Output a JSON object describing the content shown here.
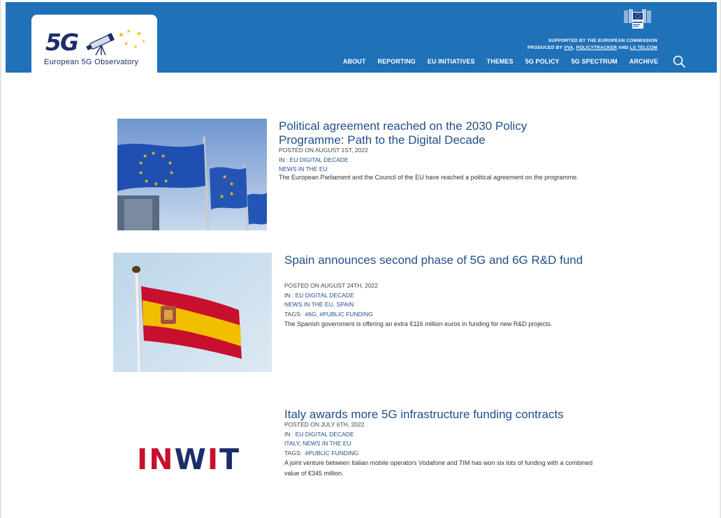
{
  "site": {
    "logo_text": "European 5G Observatory",
    "logo_mark": "5G",
    "supported_line": "SUPPORTED BY THE EUROPEAN COMMISSION",
    "produced_prefix": "PRODUCED BY",
    "produced_vva": "VVA",
    "produced_sep": ",",
    "produced_pt": "POLICYTRACKER",
    "produced_and": "AND",
    "produced_ls": "LS TELCOM",
    "brand_color": "#1f71b8"
  },
  "nav": {
    "items": [
      "ABOUT",
      "REPORTING",
      "EU INITIATIVES",
      "THEMES",
      "5G POLICY",
      "5G SPECTRUM",
      "ARCHIVE"
    ],
    "search_icon": "search-icon"
  },
  "articles": [
    {
      "title": "Political agreement reached on the 2030 Policy Programme: Path to the Digital Decade",
      "posted": "POSTED ON AUGUST 1ST, 2022",
      "in_prefix": "IN :",
      "in_category": "EU DIGITAL DECADE",
      "subcats": "NEWS IN THE EU",
      "tags_prefix": "",
      "tags": "",
      "excerpt": "The European Parliament and the Council of the EU have reached a political agreement on the programme."
    },
    {
      "title": "Spain announces second phase of 5G and 6G R&D fund",
      "posted": "POSTED ON AUGUST 24TH, 2022",
      "in_prefix": "IN :",
      "in_category": "EU DIGITAL DECADE",
      "subcats": "NEWS IN THE EU, SPAIN",
      "tags_prefix": "TAGS:",
      "tags": "#6G, #PUBLIC FUNDING",
      "excerpt": "The Spanish government is offering an extra €116 million euros in funding for new R&D projects."
    },
    {
      "title": "Italy awards more 5G infrastructure funding contracts",
      "posted": "POSTED ON JULY 6TH, 2022",
      "in_prefix": "IN :",
      "in_category": "EU DIGITAL DECADE",
      "subcats": "ITALY, NEWS IN THE EU",
      "tags_prefix": "TAGS:",
      "tags": "#PUBLIC FUNDING",
      "excerpt": "A joint venture between Italian mobile operators Vodafone and TIM has won six lots of funding with a combined value of €345 million.",
      "logo_text": "INWIT"
    }
  ]
}
